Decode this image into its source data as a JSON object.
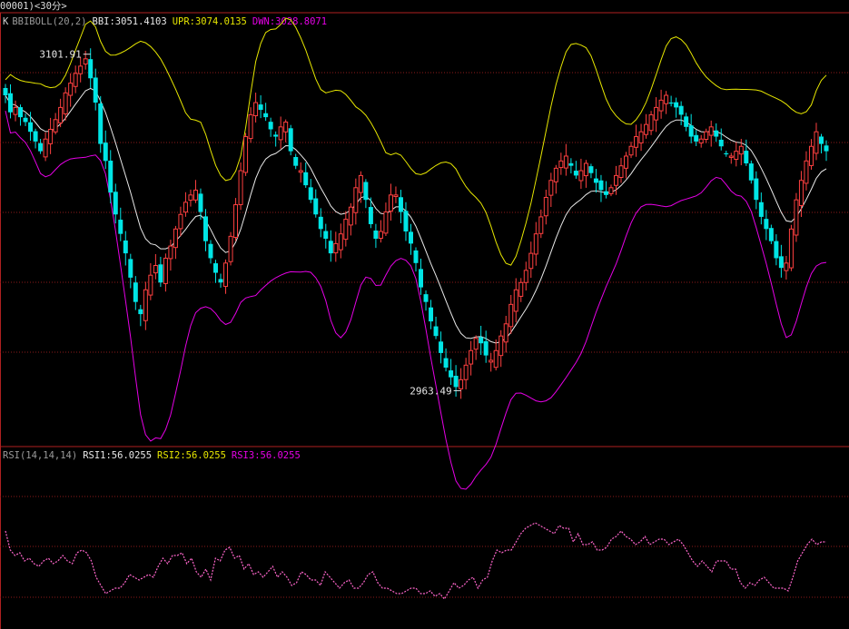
{
  "window": {
    "title": "00001)<30分>"
  },
  "main_panel": {
    "k_label": "K",
    "indicator": "BBIBOLL(20,2)",
    "bbi_text": "BBI:3051.4103",
    "upr_text": "UPR:3074.0135",
    "dwn_text": "DWN:3028.8071",
    "high_label": "3101.91",
    "low_label": "2963.49"
  },
  "rsi_panel": {
    "indicator": "RSI(14,14,14)",
    "rsi1_text": "RSI1:56.0255",
    "rsi2_text": "RSI2:56.0255",
    "rsi3_text": "RSI3:56.0255"
  },
  "colors": {
    "up": "#ff4040",
    "down": "#00e5e5",
    "bbi": "#e8e8e8",
    "upr": "#e6e600",
    "dwn": "#e600e6",
    "rsi": "#ff66cc",
    "grid": "#8b1a1a",
    "frame": "#b02020",
    "text": "#d0d0d0"
  },
  "chart_data": {
    "type": "candlestick",
    "ylim": [
      2945,
      3113
    ],
    "high_marker": 3101.91,
    "low_marker": 2963.49,
    "close": [
      3085,
      3078,
      3080,
      3076,
      3074,
      3070,
      3066,
      3062,
      3067,
      3071,
      3075,
      3080,
      3086,
      3090,
      3094,
      3097,
      3100,
      3092,
      3082,
      3065,
      3058,
      3045,
      3036,
      3028,
      3020,
      3010,
      3000,
      2995,
      3005,
      3011,
      3015,
      3008,
      3018,
      3023,
      3030,
      3036,
      3041,
      3044,
      3046,
      3037,
      3025,
      3018,
      3012,
      3008,
      3016,
      3027,
      3040,
      3054,
      3068,
      3077,
      3082,
      3079,
      3076,
      3071,
      3068,
      3072,
      3074,
      3062,
      3056,
      3054,
      3048,
      3042,
      3036,
      3030,
      3026,
      3020,
      3024,
      3028,
      3034,
      3039,
      3047,
      3052,
      3042,
      3032,
      3026,
      3029,
      3037,
      3044,
      3044,
      3037,
      3029,
      3024,
      3016,
      3006,
      3000,
      2992,
      2986,
      2979,
      2973,
      2969,
      2965,
      2968,
      2974,
      2980,
      2985,
      2983,
      2978,
      2976,
      2980,
      2986,
      2991,
      2999,
      3005,
      3008,
      3013,
      3020,
      3028,
      3035,
      3043,
      3050,
      3055,
      3058,
      3060,
      3056,
      3052,
      3054,
      3057,
      3053,
      3049,
      3046,
      3044,
      3047,
      3052,
      3056,
      3060,
      3064,
      3068,
      3070,
      3073,
      3077,
      3080,
      3083,
      3085,
      3082,
      3080,
      3077,
      3072,
      3068,
      3066,
      3067,
      3070,
      3072,
      3068,
      3064,
      3061,
      3060,
      3062,
      3064,
      3057,
      3050,
      3042,
      3035,
      3030,
      3025,
      3018,
      3014,
      3016,
      3030,
      3042,
      3050,
      3058,
      3064,
      3070,
      3065,
      3062
    ],
    "rsi": [
      55,
      48,
      46,
      47,
      44,
      45,
      43,
      42,
      44,
      45,
      43,
      44,
      46,
      44,
      43,
      47,
      48,
      47,
      44,
      38,
      35,
      32,
      33,
      34,
      34,
      36,
      39,
      38,
      37,
      38,
      39,
      38,
      42,
      45,
      43,
      46,
      46,
      47,
      43,
      45,
      40,
      38,
      41,
      37,
      45,
      44,
      48,
      49,
      45,
      46,
      41,
      43,
      39,
      40,
      38,
      40,
      42,
      38,
      40,
      38,
      35,
      36,
      40,
      39,
      37,
      37,
      35,
      40,
      38,
      36,
      34,
      36,
      37,
      34,
      34,
      36,
      39,
      40,
      36,
      34,
      34,
      33,
      32,
      32,
      33,
      34,
      34,
      32,
      32,
      33,
      31,
      32,
      30,
      33,
      36,
      34,
      35,
      37,
      38,
      34,
      37,
      38,
      44,
      48,
      47,
      48,
      48,
      51,
      54,
      56,
      57,
      58,
      57,
      56,
      55,
      54,
      57,
      56,
      56,
      51,
      54,
      50,
      50,
      51,
      48,
      48,
      49,
      52,
      53,
      55,
      53,
      52,
      50,
      51,
      53,
      50,
      51,
      52,
      52,
      50,
      51,
      52,
      50,
      47,
      44,
      42,
      44,
      42,
      40,
      44,
      44,
      44,
      41,
      41,
      36,
      34,
      36,
      35,
      37,
      38,
      36,
      34,
      34,
      34,
      33,
      38,
      44,
      47,
      50,
      52,
      50,
      51,
      51
    ]
  }
}
